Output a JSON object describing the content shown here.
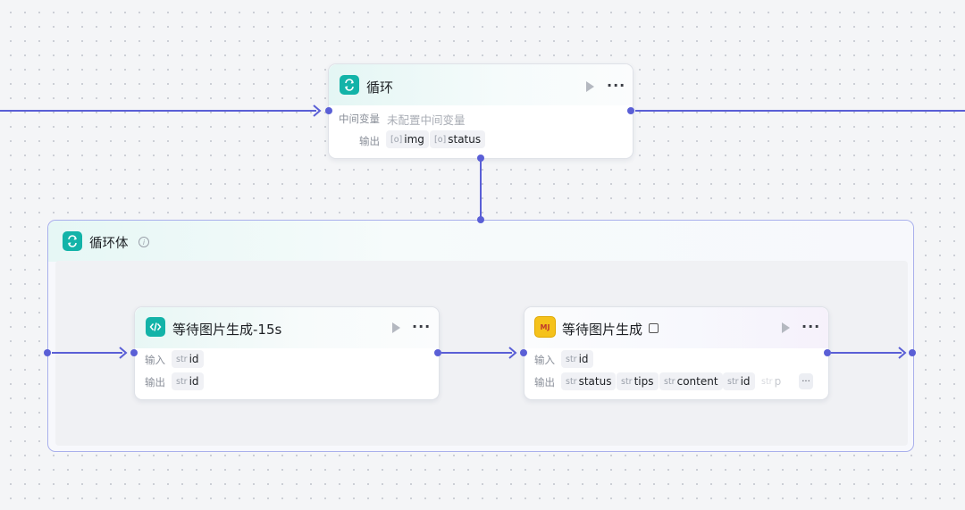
{
  "loop_node": {
    "icon": "loop-icon",
    "title": "循环",
    "intermediate_label": "中间变量",
    "intermediate_value": "未配置中间变量",
    "output_label": "输出",
    "outputs": [
      {
        "type": "[o]",
        "name": "img"
      },
      {
        "type": "[o]",
        "name": "status"
      }
    ]
  },
  "loop_body": {
    "icon": "loop-icon",
    "title": "循环体",
    "info": "i"
  },
  "code_node": {
    "icon": "code-icon",
    "title": "等待图片生成-15s",
    "input_label": "输入",
    "output_label": "输出",
    "inputs": [
      {
        "type": "str",
        "name": "id"
      }
    ],
    "outputs": [
      {
        "type": "str",
        "name": "id"
      }
    ]
  },
  "plugin_node": {
    "icon": "plugin-icon",
    "icon_text": "MJ",
    "title": "等待图片生成",
    "badge_icon": "plugin-badge-icon",
    "input_label": "输入",
    "output_label": "输出",
    "inputs": [
      {
        "type": "str",
        "name": "id"
      }
    ],
    "outputs": [
      {
        "type": "str",
        "name": "status"
      },
      {
        "type": "str",
        "name": "tips"
      },
      {
        "type": "str",
        "name": "content"
      },
      {
        "type": "str",
        "name": "id"
      },
      {
        "type": "str",
        "name": "p"
      }
    ],
    "more_label": "···"
  },
  "colors": {
    "edge": "#5a5fd6",
    "accent_teal": "#13b3a8",
    "group_border": "#a9b0ec"
  },
  "icons": {
    "run": "play-icon",
    "more": "more-icon"
  },
  "more_text": "···"
}
